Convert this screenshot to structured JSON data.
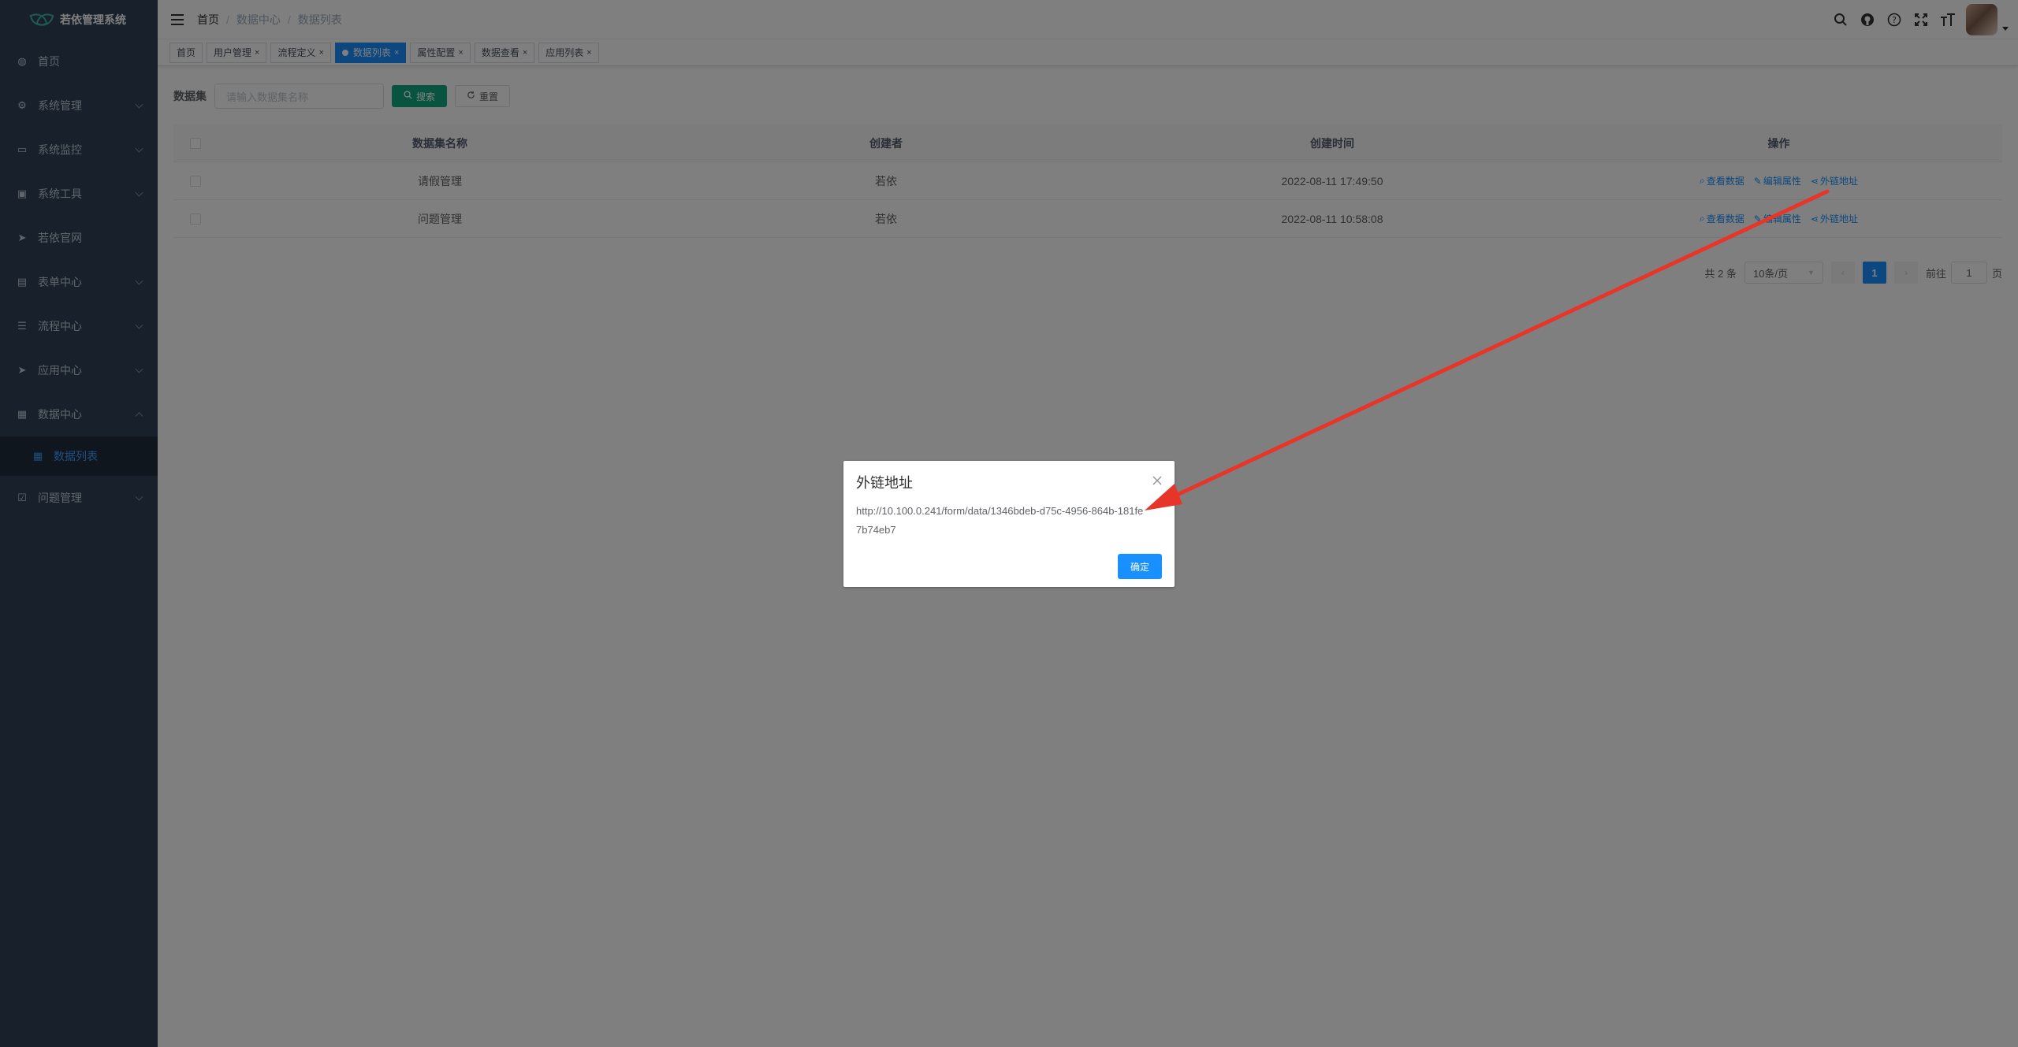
{
  "app": {
    "title": "若依管理系统"
  },
  "sidebar": {
    "items": [
      {
        "label": "首页",
        "icon": "dashboard-icon",
        "glyph": "◍"
      },
      {
        "label": "系统管理",
        "icon": "gear-icon",
        "glyph": "⚙"
      },
      {
        "label": "系统监控",
        "icon": "monitor-icon",
        "glyph": "▭"
      },
      {
        "label": "系统工具",
        "icon": "toolbox-icon",
        "glyph": "▣"
      },
      {
        "label": "若依官网",
        "icon": "send-icon",
        "glyph": "➤"
      },
      {
        "label": "表单中心",
        "icon": "form-icon",
        "glyph": "▤"
      },
      {
        "label": "流程中心",
        "icon": "flow-icon",
        "glyph": "☰"
      },
      {
        "label": "应用中心",
        "icon": "app-icon",
        "glyph": "➤"
      },
      {
        "label": "数据中心",
        "icon": "data-icon",
        "glyph": "▦"
      },
      {
        "label": "问题管理",
        "icon": "question-icon",
        "glyph": "☑"
      }
    ],
    "subitem": {
      "label": "数据列表",
      "glyph": "▦"
    }
  },
  "header": {
    "breadcrumb": [
      "首页",
      "数据中心",
      "数据列表"
    ],
    "sep": "/"
  },
  "tags": [
    {
      "label": "首页"
    },
    {
      "label": "用户管理"
    },
    {
      "label": "流程定义"
    },
    {
      "label": "数据列表"
    },
    {
      "label": "属性配置"
    },
    {
      "label": "数据查看"
    },
    {
      "label": "应用列表"
    }
  ],
  "tag_close": "×",
  "search": {
    "label": "数据集",
    "placeholder": "请输入数据集名称",
    "search_btn": "搜索",
    "reset_btn": "重置"
  },
  "table": {
    "headers": [
      "数据集名称",
      "创建者",
      "创建时间",
      "操作"
    ],
    "rows": [
      {
        "name": "请假管理",
        "creator": "若依",
        "time": "2022-08-11 17:49:50"
      },
      {
        "name": "问题管理",
        "creator": "若依",
        "time": "2022-08-11 10:58:08"
      }
    ],
    "ops": [
      "查看数据",
      "编辑属性",
      "外链地址"
    ]
  },
  "pagination": {
    "total": "共 2 条",
    "page_size": "10条/页",
    "current": "1",
    "goto_prefix": "前往",
    "goto_value": "1",
    "goto_suffix": "页"
  },
  "dialog": {
    "title": "外链地址",
    "url": "http://10.100.0.241/form/data/1346bdeb-d75c-4956-864b-181fe7b74eb7",
    "ok": "确定"
  },
  "colors": {
    "sidebar_bg": "#304156",
    "primary": "#1890ff",
    "search_btn": "#11a983",
    "annotation_arrow": "#e8352a"
  }
}
